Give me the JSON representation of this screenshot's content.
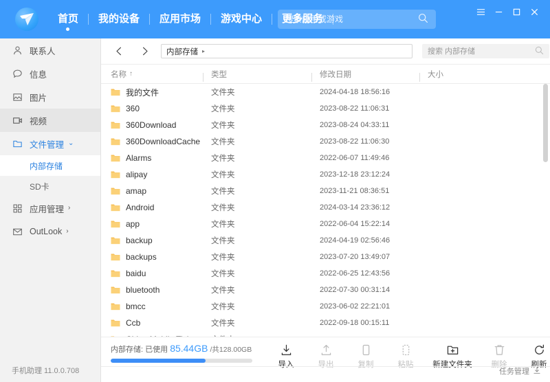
{
  "header": {
    "logo_icon": "paper-plane-logo",
    "nav": [
      {
        "label": "首页",
        "active": true
      },
      {
        "label": "我的设备",
        "active": false
      },
      {
        "label": "应用市场",
        "active": false
      },
      {
        "label": "游戏中心",
        "active": false
      },
      {
        "label": "更多服务",
        "active": false
      }
    ],
    "search": {
      "value": "",
      "placeholder": "搜索应用或游戏",
      "icon": "search-icon"
    },
    "window_controls": [
      {
        "name": "menu-button",
        "glyph": "☰"
      },
      {
        "name": "minimize-button",
        "glyph": "—"
      },
      {
        "name": "maximize-button",
        "glyph": "▢"
      },
      {
        "name": "close-button",
        "glyph": "✕"
      }
    ],
    "accent_color": "#3d9bfc"
  },
  "sidebar": {
    "items": [
      {
        "label": "联系人",
        "icon": "contact-icon",
        "state": "normal"
      },
      {
        "label": "信息",
        "icon": "message-icon",
        "state": "normal"
      },
      {
        "label": "图片",
        "icon": "picture-icon",
        "state": "normal"
      },
      {
        "label": "视频",
        "icon": "video-icon",
        "state": "hover"
      },
      {
        "label": "文件管理",
        "icon": "folder-icon",
        "state": "expanded",
        "chevron": "⌄"
      }
    ],
    "sub_items": [
      {
        "label": "内部存储",
        "selected": true
      },
      {
        "label": "SD卡",
        "selected": false
      }
    ],
    "items_after": [
      {
        "label": "应用管理",
        "icon": "apps-icon",
        "chevron": "›"
      },
      {
        "label": "OutLook",
        "icon": "mail-icon",
        "chevron": "›"
      }
    ],
    "version": "手机助理 11.0.0.708"
  },
  "toolbar": {
    "back_icon": "arrow-left-icon",
    "forward_icon": "arrow-right-icon",
    "breadcrumb": {
      "path": "内部存储",
      "separator": "▸"
    },
    "search": {
      "value": "",
      "placeholder": "搜索 内部存储",
      "icon": "search-icon"
    }
  },
  "table": {
    "columns": [
      {
        "key": "name",
        "label": "名称",
        "sort": "↑"
      },
      {
        "key": "type",
        "label": "类型",
        "sort": ""
      },
      {
        "key": "date",
        "label": "修改日期",
        "sort": ""
      },
      {
        "key": "size",
        "label": "大小",
        "sort": ""
      }
    ],
    "rows": [
      {
        "name": "我的文件",
        "type": "文件夹",
        "date": "2024-04-18 18:56:16",
        "size": ""
      },
      {
        "name": "360",
        "type": "文件夹",
        "date": "2023-08-22 11:06:31",
        "size": ""
      },
      {
        "name": "360Download",
        "type": "文件夹",
        "date": "2023-08-24 04:33:11",
        "size": ""
      },
      {
        "name": "360DownloadCache",
        "type": "文件夹",
        "date": "2023-08-22 11:06:30",
        "size": ""
      },
      {
        "name": "Alarms",
        "type": "文件夹",
        "date": "2022-06-07 11:49:46",
        "size": ""
      },
      {
        "name": "alipay",
        "type": "文件夹",
        "date": "2023-12-18 23:12:24",
        "size": ""
      },
      {
        "name": "amap",
        "type": "文件夹",
        "date": "2023-11-21 08:36:51",
        "size": ""
      },
      {
        "name": "Android",
        "type": "文件夹",
        "date": "2024-03-14 23:36:12",
        "size": ""
      },
      {
        "name": "app",
        "type": "文件夹",
        "date": "2022-06-04 15:22:14",
        "size": ""
      },
      {
        "name": "backup",
        "type": "文件夹",
        "date": "2024-04-19 02:56:46",
        "size": ""
      },
      {
        "name": "backups",
        "type": "文件夹",
        "date": "2023-07-20 13:49:07",
        "size": ""
      },
      {
        "name": "baidu",
        "type": "文件夹",
        "date": "2022-06-25 12:43:56",
        "size": ""
      },
      {
        "name": "bluetooth",
        "type": "文件夹",
        "date": "2022-07-30 00:31:14",
        "size": ""
      },
      {
        "name": "bmcc",
        "type": "文件夹",
        "date": "2023-06-02 22:21:01",
        "size": ""
      },
      {
        "name": "Ccb",
        "type": "文件夹",
        "date": "2022-09-18 00:15:11",
        "size": ""
      },
      {
        "name": "China Mobile Ticket",
        "type": "文件夹",
        "date": "",
        "size": ""
      }
    ],
    "folder_icon": "folder-icon",
    "scrollbar": "vertical-scrollbar"
  },
  "status": {
    "storage_label": "内部存储: 已使用",
    "storage_used": "85.44GB",
    "storage_total": "/共128.00GB",
    "progress_percent": 67,
    "progress_color": "#3d8ef7"
  },
  "actions": [
    {
      "label": "导入",
      "icon": "import-icon",
      "enabled": true
    },
    {
      "label": "导出",
      "icon": "export-icon",
      "enabled": false
    },
    {
      "label": "复制",
      "icon": "copy-icon",
      "enabled": false
    },
    {
      "label": "粘贴",
      "icon": "paste-icon",
      "enabled": false
    },
    {
      "label": "新建文件夹",
      "icon": "new-folder-icon",
      "enabled": true
    },
    {
      "label": "删除",
      "icon": "trash-icon",
      "enabled": false
    },
    {
      "label": "刷新",
      "icon": "refresh-icon",
      "enabled": true
    }
  ],
  "task_manager": {
    "label": "任务管理",
    "icon": "download-arrow-icon"
  }
}
